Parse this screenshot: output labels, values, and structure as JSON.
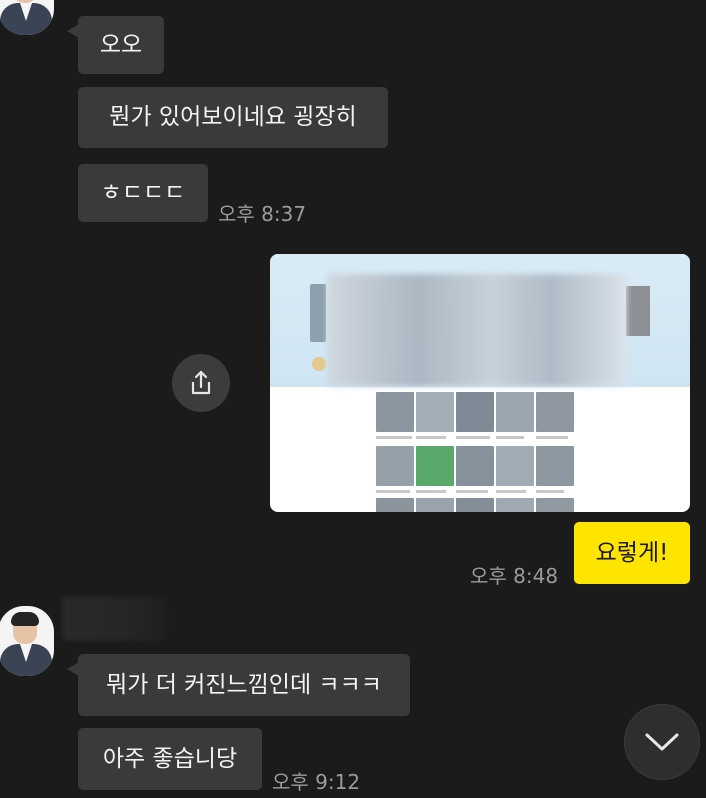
{
  "chat": {
    "messages": [
      {
        "sender": "other",
        "text": "오오"
      },
      {
        "sender": "other",
        "text": "뭔가 있어보이네요 굉장히"
      },
      {
        "sender": "other",
        "text": "ㅎㄷㄷㄷ",
        "time": "오후 8:37"
      },
      {
        "sender": "me",
        "type": "image"
      },
      {
        "sender": "me",
        "text": "요렇게!",
        "time": "오후 8:48"
      },
      {
        "sender": "other",
        "text": "뭐가 더 커진느낌인데 ㅋㅋㅋ"
      },
      {
        "sender": "other",
        "text": "아주 좋습니당",
        "time": "오후 9:12"
      }
    ]
  },
  "colors": {
    "background": "#1b1b1b",
    "incoming_bubble": "#3a3a3a",
    "outgoing_bubble": "#fee500",
    "timestamp": "#9b9b9b"
  },
  "icons": {
    "share": "share-icon",
    "scroll_down": "chevron-down-icon"
  }
}
